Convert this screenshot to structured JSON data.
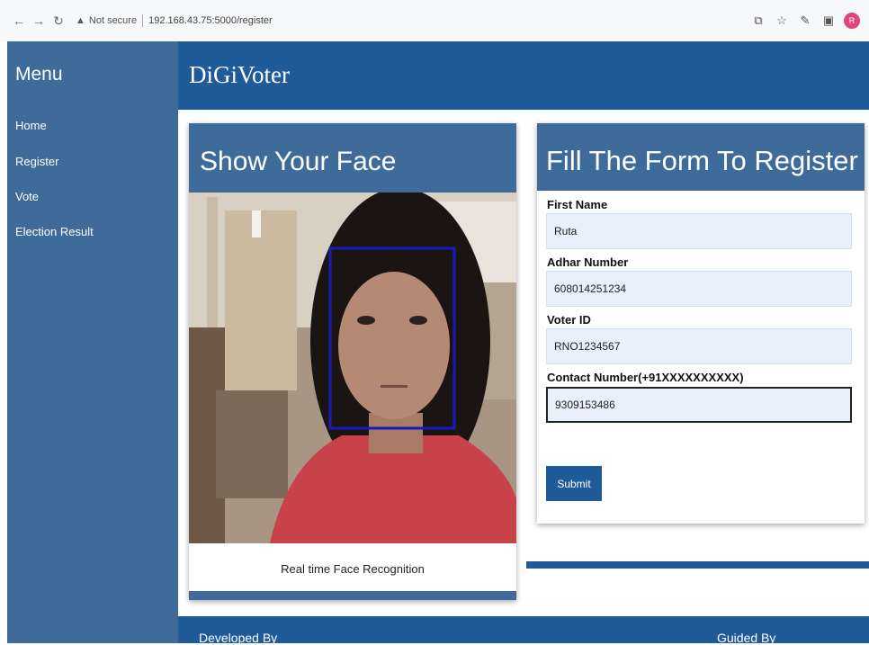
{
  "browser": {
    "back_icon": "arrow-left",
    "forward_icon": "arrow-right",
    "reload_icon": "reload",
    "security_label": "Not secure",
    "url": "192.168.43.75:5000/register",
    "profile_initial": "R"
  },
  "sidebar": {
    "title": "Menu",
    "items": [
      {
        "label": "Home"
      },
      {
        "label": "Register"
      },
      {
        "label": "Vote"
      },
      {
        "label": "Election Result"
      }
    ]
  },
  "header": {
    "brand": "DiGiVoter"
  },
  "face_card": {
    "title": "Show Your Face",
    "caption": "Real time Face Recognition"
  },
  "form_card": {
    "title": "Fill The Form To Register",
    "fields": [
      {
        "label": "First Name",
        "value": "Ruta"
      },
      {
        "label": "Adhar Number",
        "value": "608014251234"
      },
      {
        "label": "Voter ID",
        "value": "RNO1234567"
      },
      {
        "label": "Contact Number(+91XXXXXXXXXX)",
        "value": "9309153486"
      }
    ],
    "submit_label": "Submit"
  },
  "footer": {
    "left": "Developed By",
    "right": "Guided By"
  },
  "colors": {
    "sidebar": "#3f6b9a",
    "header": "#1f5a99",
    "input_bg": "#e8f0fb"
  }
}
